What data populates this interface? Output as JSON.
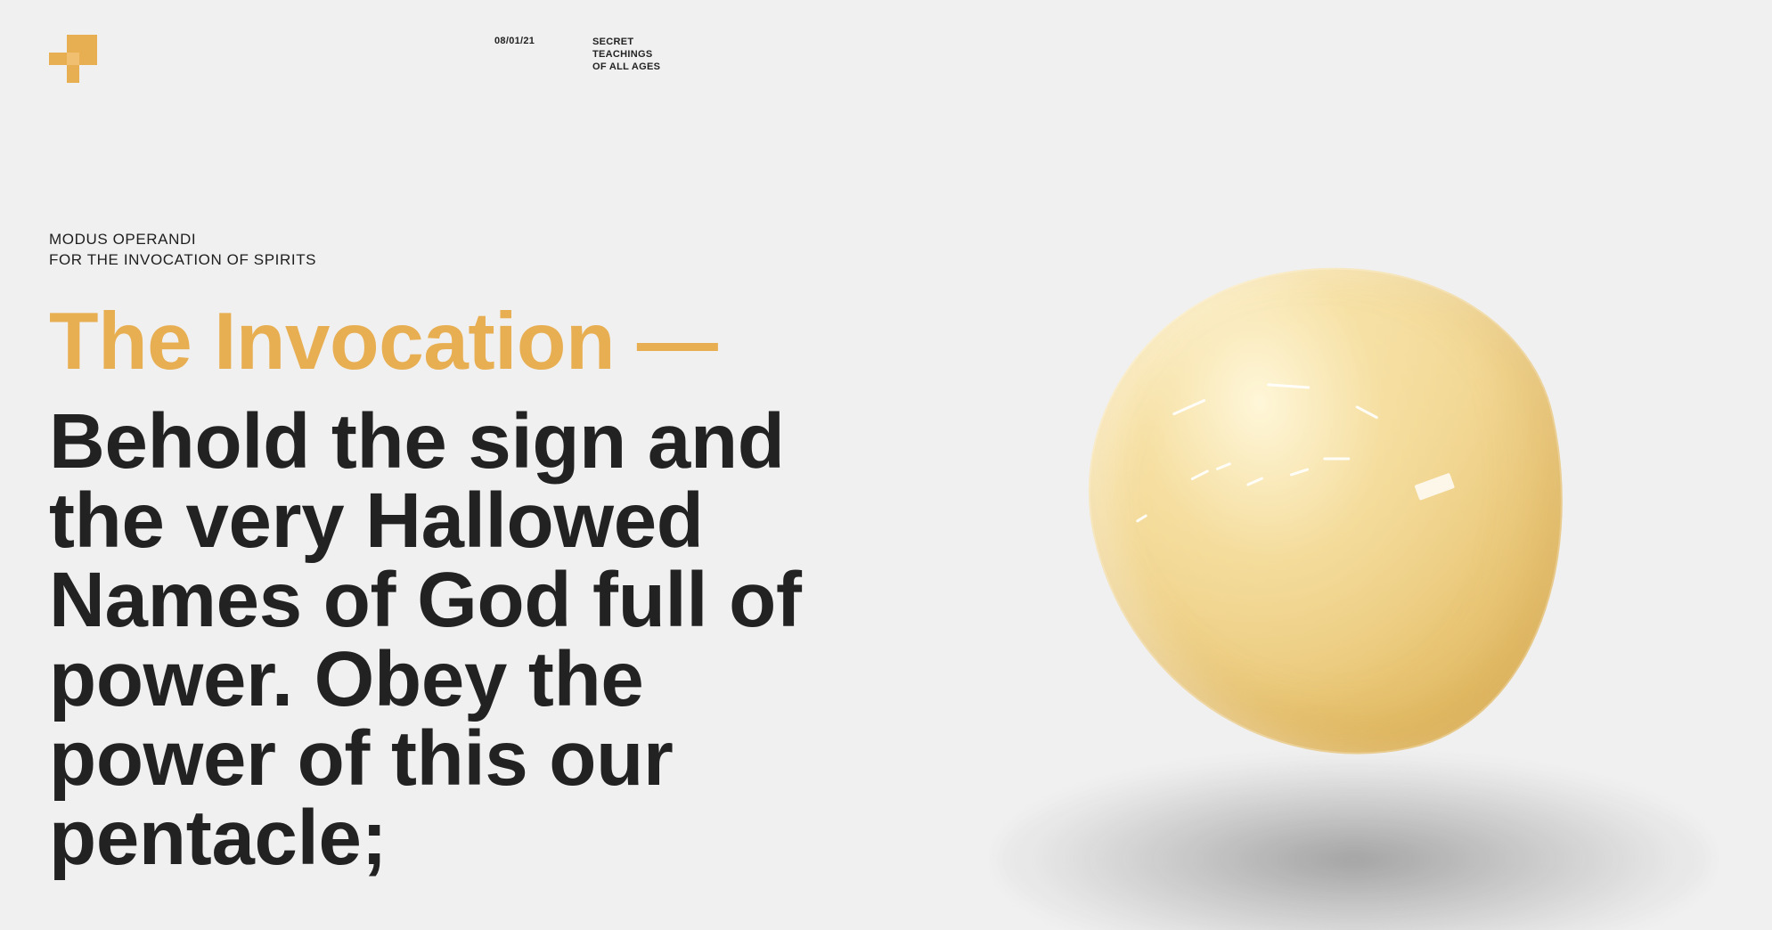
{
  "brand": {
    "logo_icon": "stacked-squares-logo-icon",
    "accent_color": "#e8ae52"
  },
  "header": {
    "date": "08/01/21",
    "tagline_lines": [
      "SECRET",
      "TEACHINGS",
      "OF ALL AGES"
    ]
  },
  "hero": {
    "subtitle_lines": [
      "MODUS OPERANDI",
      "FOR THE INVOCATION OF SPIRITS"
    ],
    "heading_accent": "The Invocation —",
    "heading_main": "Behold the sign and the very Hallowed Names of God full of power. Obey the power of this our pentacle;"
  },
  "visual": {
    "object": "glossy-yellow-blob",
    "color": "#f1d590"
  },
  "colors": {
    "background": "#f0f0f0",
    "text": "#222222"
  }
}
